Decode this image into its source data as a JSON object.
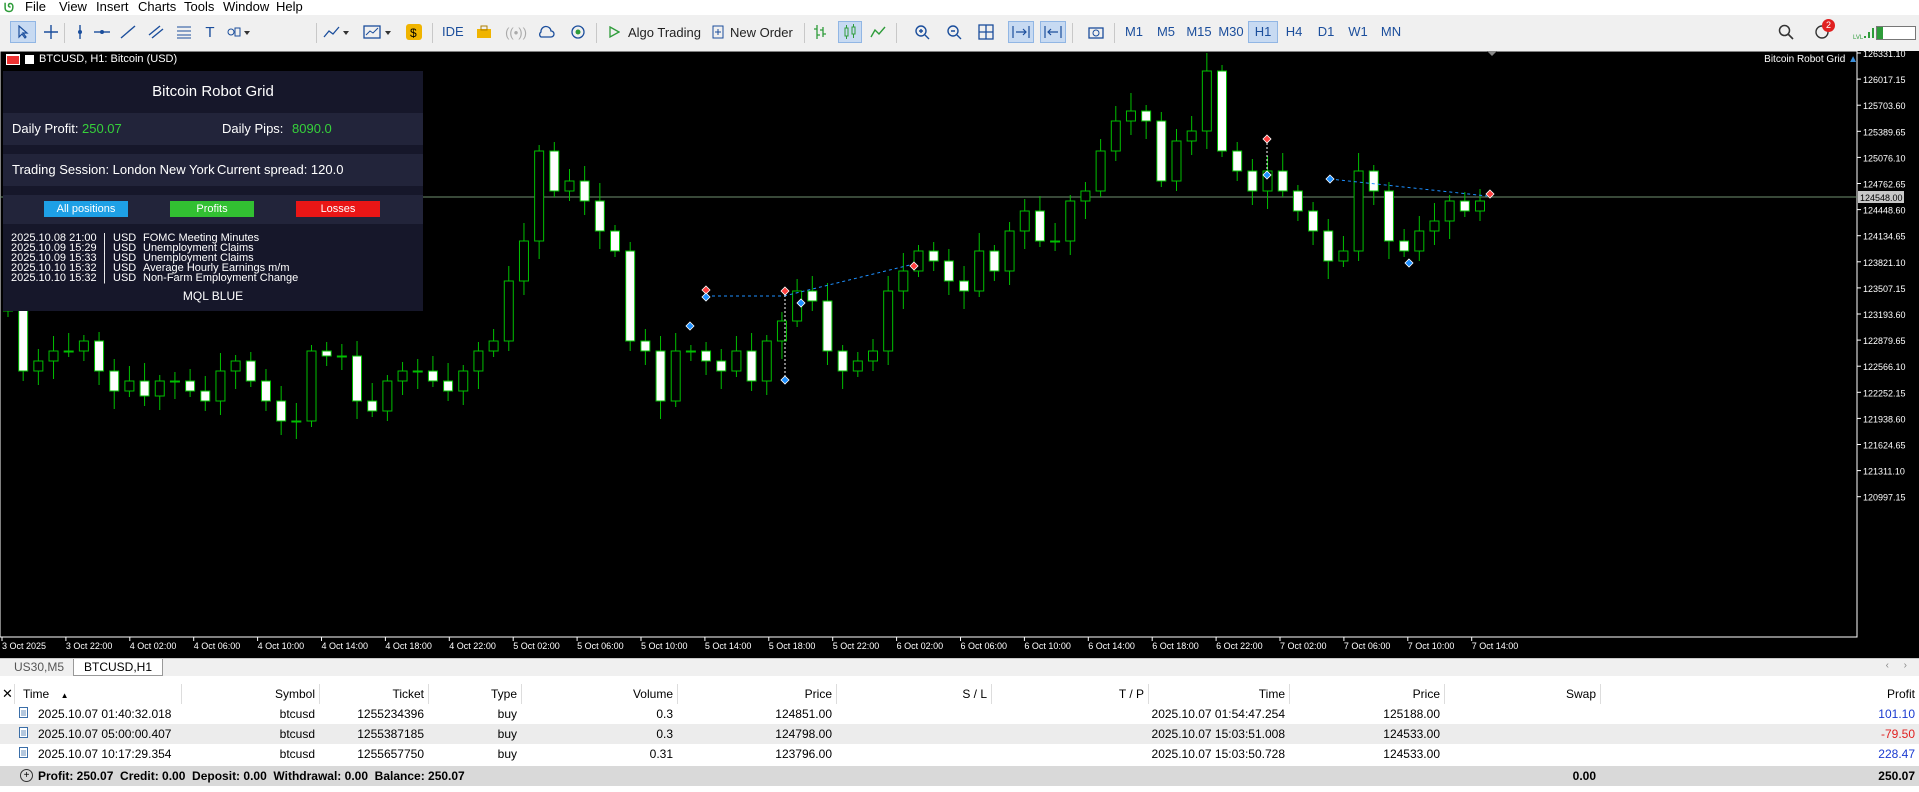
{
  "menu": [
    "File",
    "Insert",
    "View",
    "Charts",
    "Tools",
    "Window",
    "Help"
  ],
  "toolbar": {
    "ide_label": "IDE",
    "algo_trading_label": "Algo Trading",
    "new_order_label": "New Order",
    "timeframes": [
      "M1",
      "M5",
      "M15",
      "M30",
      "H1",
      "H4",
      "D1",
      "W1",
      "MN"
    ],
    "active_timeframe": "H1",
    "notification_count": "2",
    "lvl_label": "LVL"
  },
  "chart": {
    "title": "BTCUSD, H1:  Bitcoin (USD)",
    "indicator_label": "Bitcoin Robot Grid",
    "current_price_label": "124548.00",
    "price_ticks": [
      "126331.10",
      "126017.15",
      "125703.60",
      "125389.65",
      "125076.10",
      "124762.65",
      "124448.60",
      "124134.65",
      "123821.10",
      "123507.15",
      "123193.60",
      "122879.65",
      "122566.10",
      "122252.15",
      "121938.60",
      "121624.65",
      "121311.10",
      "120997.15"
    ],
    "time_ticks": [
      "3 Oct 2025",
      "3 Oct 22:00",
      "4 Oct 02:00",
      "4 Oct 06:00",
      "4 Oct 10:00",
      "4 Oct 14:00",
      "4 Oct 18:00",
      "4 Oct 22:00",
      "5 Oct 02:00",
      "5 Oct 06:00",
      "5 Oct 10:00",
      "5 Oct 14:00",
      "5 Oct 18:00",
      "5 Oct 22:00",
      "6 Oct 02:00",
      "6 Oct 06:00",
      "6 Oct 10:00",
      "6 Oct 14:00",
      "6 Oct 18:00",
      "6 Oct 22:00",
      "7 Oct 02:00",
      "7 Oct 06:00",
      "7 Oct 10:00",
      "7 Oct 14:00"
    ],
    "colors": {
      "bull": "#00c000",
      "bear": "#ffffff",
      "background": "#000000",
      "buy_marker": "#1e90ff",
      "sell_marker": "#ff4040"
    }
  },
  "panel": {
    "title": "Bitcoin Robot Grid",
    "daily_profit_label": "Daily Profit:",
    "daily_profit_value": "250.07",
    "daily_pips_label": "Daily Pips:",
    "daily_pips_value": "8090.0",
    "session_text": "Trading Session: London New York",
    "spread_text": "Current spread: 120.0",
    "buttons": {
      "all_positions": "All positions",
      "profits": "Profits",
      "losses": "Losses"
    },
    "news": [
      {
        "time": "2025.10.08 21:00",
        "currency": "USD",
        "event": "FOMC Meeting Minutes"
      },
      {
        "time": "2025.10.09 15:29",
        "currency": "USD",
        "event": "Unemployment Claims"
      },
      {
        "time": "2025.10.09 15:33",
        "currency": "USD",
        "event": "Unemployment Claims"
      },
      {
        "time": "2025.10.10 15:32",
        "currency": "USD",
        "event": "Average Hourly Earnings m/m"
      },
      {
        "time": "2025.10.10 15:32",
        "currency": "USD",
        "event": "Non-Farm Employment Change"
      }
    ],
    "footer": "MQL BLUE"
  },
  "tabs": [
    "US30,M5",
    "BTCUSD,H1"
  ],
  "active_tab": "BTCUSD,H1",
  "table": {
    "headers": {
      "time": "Time",
      "symbol": "Symbol",
      "ticket": "Ticket",
      "type": "Type",
      "volume": "Volume",
      "price": "Price",
      "sl": "S / L",
      "tp": "T / P",
      "time2": "Time",
      "price2": "Price",
      "swap": "Swap",
      "profit": "Profit"
    },
    "rows": [
      {
        "time": "2025.10.07 01:40:32.018",
        "symbol": "btcusd",
        "ticket": "1255234396",
        "type": "buy",
        "volume": "0.3",
        "price": "124851.00",
        "sl": "",
        "tp": "",
        "time2": "2025.10.07 01:54:47.254",
        "price2": "125188.00",
        "swap": "",
        "profit": "101.10"
      },
      {
        "time": "2025.10.07 05:00:00.407",
        "symbol": "btcusd",
        "ticket": "1255387185",
        "type": "buy",
        "volume": "0.3",
        "price": "124798.00",
        "sl": "",
        "tp": "",
        "time2": "2025.10.07 15:03:51.008",
        "price2": "124533.00",
        "swap": "",
        "profit": "-79.50"
      },
      {
        "time": "2025.10.07 10:17:29.354",
        "symbol": "btcusd",
        "ticket": "1255657750",
        "type": "buy",
        "volume": "0.31",
        "price": "123796.00",
        "sl": "",
        "tp": "",
        "time2": "2025.10.07 15:03:50.728",
        "price2": "124533.00",
        "swap": "",
        "profit": "228.47"
      }
    ],
    "footer": {
      "summary": "Profit: 250.07  Credit: 0.00  Deposit: 0.00  Withdrawal: 0.00  Balance: 250.07",
      "swap_total": "0.00",
      "profit_total": "250.07"
    }
  }
}
